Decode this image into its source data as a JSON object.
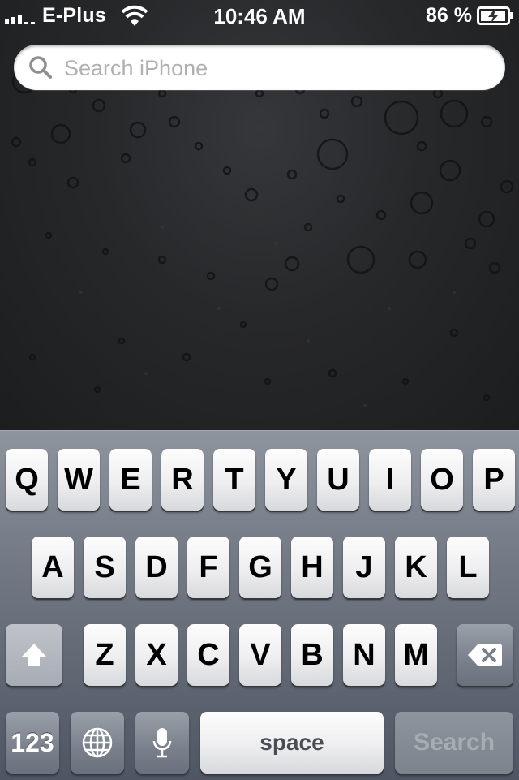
{
  "status_bar": {
    "carrier": "E-Plus",
    "time": "10:46 AM",
    "battery_percent": "86 %",
    "signal_icon": "signal-bars-icon",
    "wifi_icon": "wifi-icon",
    "battery_icon": "battery-charging-icon"
  },
  "search": {
    "placeholder": "Search iPhone",
    "value": ""
  },
  "keyboard": {
    "row1": [
      "Q",
      "W",
      "E",
      "R",
      "T",
      "Y",
      "U",
      "I",
      "O",
      "P"
    ],
    "row2": [
      "A",
      "S",
      "D",
      "F",
      "G",
      "H",
      "J",
      "K",
      "L"
    ],
    "row3": [
      "Z",
      "X",
      "C",
      "V",
      "B",
      "N",
      "M"
    ],
    "numbers_label": "123",
    "space_label": "space",
    "search_label": "Search",
    "shift_icon": "shift-arrow-icon",
    "delete_icon": "delete-backspace-icon",
    "globe_icon": "globe-icon",
    "mic_icon": "microphone-icon"
  },
  "colors": {
    "keyboard_top": "#8e949e",
    "keyboard_bottom": "#4f5663",
    "wallpaper": "#2a2b2d"
  }
}
